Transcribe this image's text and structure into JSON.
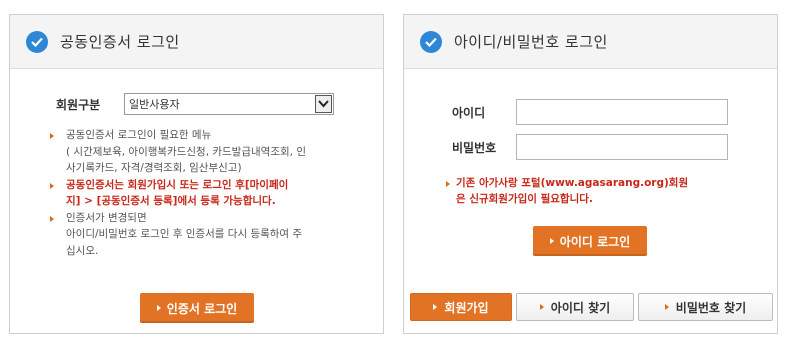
{
  "cert_login": {
    "title": "공동인증서 로그인",
    "member_type_label": "회원구분",
    "member_type_selected": "일반사용자",
    "notes": [
      {
        "style": "plain",
        "lines": [
          "공동인증서 로그인이 필요한 메뉴",
          "( 시간제보육, 아이행복카드신청, 카드발급내역조회, 인",
          "사기록카드, 자격/경력조회, 임산부신고)"
        ]
      },
      {
        "style": "red",
        "lines": [
          "공동인증서는 회원가입시 또는 로그인 후[마이페이",
          "지] > [공동인증서 등록]에서 등록 가능합니다."
        ]
      },
      {
        "style": "plain",
        "lines": [
          "인증서가 변경되면",
          "아이디/비밀번호 로그인 후 인증서를 다시 등록하여 주",
          "십시오."
        ]
      }
    ],
    "button_label": "인증서 로그인"
  },
  "id_login": {
    "title": "아이디/비밀번호 로그인",
    "id_label": "아이디",
    "id_value": "",
    "pw_label": "비밀번호",
    "pw_value": "",
    "notice_lines": [
      "기존 아가사랑 포털(www.agasarang.org)회원",
      "은 신규회원가입이 필요합니다."
    ],
    "button_label": "아이디 로그인",
    "join_label": "회원가입",
    "find_id_label": "아이디 찾기",
    "find_pw_label": "비밀번호 찾기"
  },
  "colors": {
    "accent_orange": "#e37324",
    "check_blue": "#2e86d6",
    "notice_red": "#c8281b"
  },
  "icons": {
    "panel_header": "check-circle-icon",
    "button_prefix": "arrow-right-icon",
    "select": "chevron-down-icon"
  }
}
